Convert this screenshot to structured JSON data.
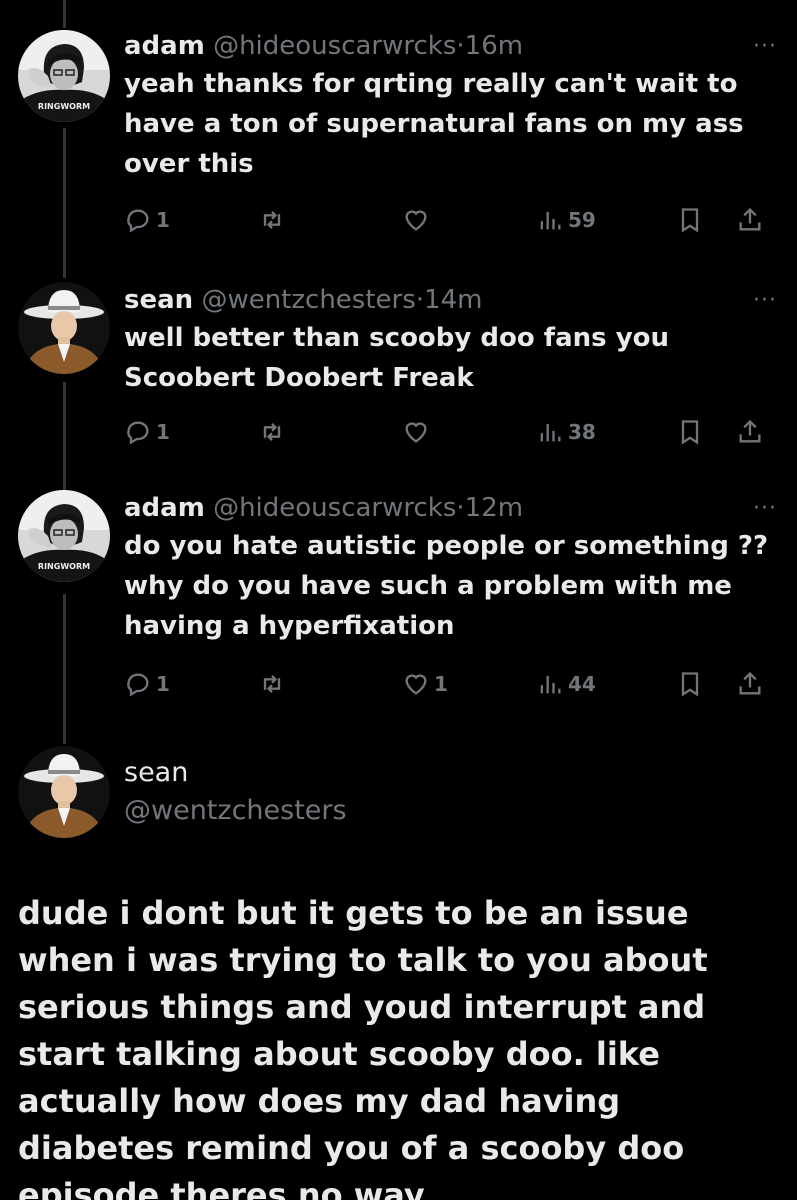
{
  "tweets": [
    {
      "name": "adam",
      "handle": "@hideouscarwrcks",
      "separator": "·",
      "time": "16m",
      "text": "yeah thanks for qrting really can't wait to have a ton of supernatural fans on my ass over this",
      "more": "···",
      "replies": "1",
      "retweets": "",
      "likes": "",
      "views": "59"
    },
    {
      "name": "sean",
      "handle": "@wentzchesters",
      "separator": "·",
      "time": "14m",
      "text": "well better than scooby doo fans you Scoobert Doobert Freak",
      "more": "···",
      "replies": "1",
      "retweets": "",
      "likes": "",
      "views": "38"
    },
    {
      "name": "adam",
      "handle": "@hideouscarwrcks",
      "separator": "·",
      "time": "12m",
      "text": "do you hate autistic people or something ?? why do you have such a problem with me having a hyperfixation",
      "more": "···",
      "replies": "1",
      "retweets": "",
      "likes": "1",
      "views": "44"
    }
  ],
  "main_tweet": {
    "name": "sean",
    "handle": "@wentzchesters",
    "text": "dude i dont but it gets to be an issue when i was trying to talk to you about serious things and youd interrupt and start talking about scooby doo. like actually how does my dad having diabetes remind you of a scooby doo episode theres no way"
  },
  "avatars": {
    "adam_shirt_text": "RINGWORM"
  },
  "icons": [
    "reply-icon",
    "retweet-icon",
    "like-icon",
    "views-icon",
    "bookmark-icon",
    "share-icon",
    "more-icon"
  ],
  "colors": {
    "background": "#000000",
    "text": "#e7e9ea",
    "secondary": "#71767b",
    "thread_line": "#333639"
  }
}
